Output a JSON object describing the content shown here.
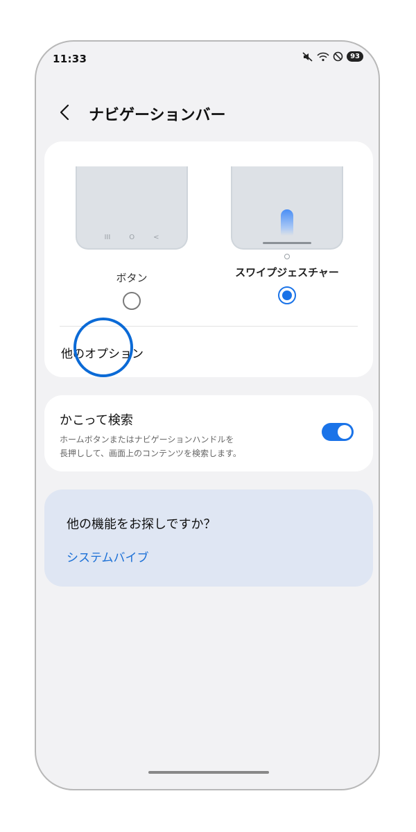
{
  "status_bar": {
    "time": "11:33",
    "battery": "93",
    "icons": [
      "mute-icon",
      "wifi-icon",
      "do-not-disturb-icon",
      "battery-icon"
    ]
  },
  "header": {
    "back_icon": "chevron-left-icon",
    "title": "ナビゲーションバー"
  },
  "navigation_type": {
    "options": [
      {
        "label": "ボタン",
        "selected": false,
        "nav_keys": [
          "III",
          "O",
          "<"
        ]
      },
      {
        "label": "スワイプジェスチャー",
        "selected": true
      }
    ],
    "other_options_label": "他のオプション"
  },
  "circle_to_search": {
    "title": "かこって検索",
    "description_line1": "ホームボタンまたはナビゲーションハンドルを",
    "description_line2": "長押しして、画面上のコンテンツを検索します。",
    "enabled": true
  },
  "more_features": {
    "question": "他の機能をお探しですか？",
    "link": "システムバイブ"
  },
  "colors": {
    "accent": "#1a73e8",
    "background": "#f2f2f4",
    "card": "#ffffff",
    "suggestion_card": "#dfe6f3",
    "link": "#1a6fd6"
  }
}
